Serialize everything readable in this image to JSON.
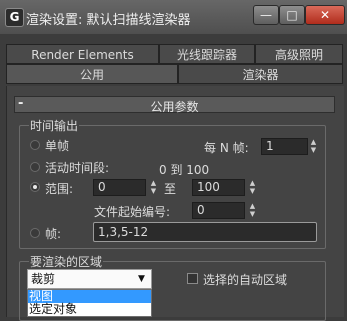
{
  "window": {
    "icon_glyph": "G",
    "title": "渲染设置: 默认扫描线渲染器",
    "minimize_glyph": "—",
    "maximize_glyph": "□",
    "close_glyph": "✕"
  },
  "tabs": {
    "row1": [
      "Render Elements",
      "光线跟踪器",
      "高级照明"
    ],
    "row2": [
      "公用",
      "渲染器"
    ]
  },
  "rollout": {
    "toggle": "-",
    "title": "公用参数"
  },
  "time_output": {
    "label": "时间输出",
    "single": "单帧",
    "every_n": "每 N 帧:",
    "every_n_value": "1",
    "active_segment": "活动时间段:",
    "active_range": "0 到 100",
    "range": "范围:",
    "range_start": "0",
    "range_to": "至",
    "range_end": "100",
    "file_start": "文件起始编号:",
    "file_start_value": "0",
    "frames": "帧:",
    "frames_value": "1,3,5-12",
    "selected_option": "range"
  },
  "render_area": {
    "label": "要渲染的区域",
    "selected": "裁剪",
    "options": [
      "视图",
      "选定对象"
    ],
    "highlighted": "视图",
    "auto_region": "选择的自动区域",
    "auto_region_checked": false
  },
  "icons": {
    "spinner": "spinner-up-down-icon",
    "dropdown": "chevron-down-icon"
  }
}
